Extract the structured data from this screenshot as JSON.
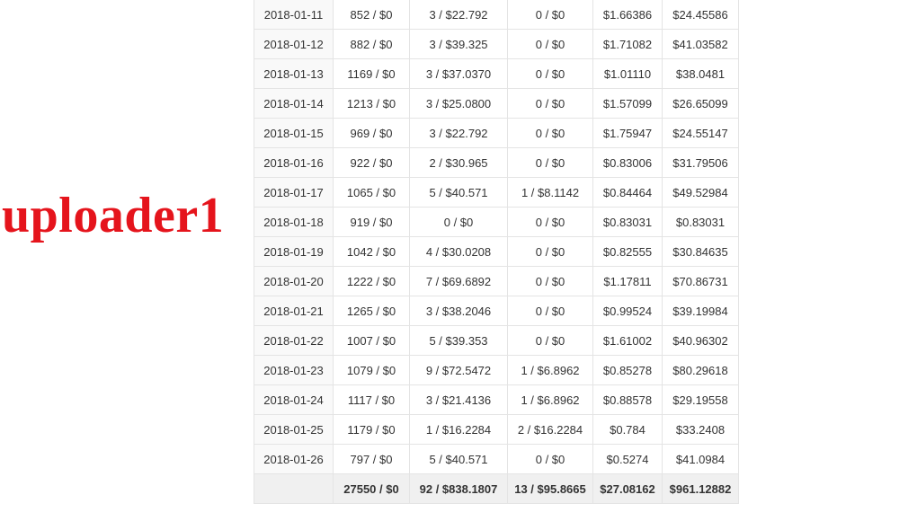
{
  "watermark": "uploader1",
  "rows": [
    {
      "date": "2018-01-11",
      "views": "852 / $0",
      "sales": "3 / $22.792",
      "refs": "0 / $0",
      "extra": "$1.66386",
      "total": "$24.45586"
    },
    {
      "date": "2018-01-12",
      "views": "882 / $0",
      "sales": "3 / $39.325",
      "refs": "0 / $0",
      "extra": "$1.71082",
      "total": "$41.03582"
    },
    {
      "date": "2018-01-13",
      "views": "1169 / $0",
      "sales": "3 / $37.0370",
      "refs": "0 / $0",
      "extra": "$1.01110",
      "total": "$38.0481"
    },
    {
      "date": "2018-01-14",
      "views": "1213 / $0",
      "sales": "3 / $25.0800",
      "refs": "0 / $0",
      "extra": "$1.57099",
      "total": "$26.65099"
    },
    {
      "date": "2018-01-15",
      "views": "969 / $0",
      "sales": "3 / $22.792",
      "refs": "0 / $0",
      "extra": "$1.75947",
      "total": "$24.55147"
    },
    {
      "date": "2018-01-16",
      "views": "922 / $0",
      "sales": "2 / $30.965",
      "refs": "0 / $0",
      "extra": "$0.83006",
      "total": "$31.79506"
    },
    {
      "date": "2018-01-17",
      "views": "1065 / $0",
      "sales": "5 / $40.571",
      "refs": "1 / $8.1142",
      "extra": "$0.84464",
      "total": "$49.52984"
    },
    {
      "date": "2018-01-18",
      "views": "919 / $0",
      "sales": "0 / $0",
      "refs": "0 / $0",
      "extra": "$0.83031",
      "total": "$0.83031"
    },
    {
      "date": "2018-01-19",
      "views": "1042 / $0",
      "sales": "4 / $30.0208",
      "refs": "0 / $0",
      "extra": "$0.82555",
      "total": "$30.84635"
    },
    {
      "date": "2018-01-20",
      "views": "1222 / $0",
      "sales": "7 / $69.6892",
      "refs": "0 / $0",
      "extra": "$1.17811",
      "total": "$70.86731"
    },
    {
      "date": "2018-01-21",
      "views": "1265 / $0",
      "sales": "3 / $38.2046",
      "refs": "0 / $0",
      "extra": "$0.99524",
      "total": "$39.19984"
    },
    {
      "date": "2018-01-22",
      "views": "1007 / $0",
      "sales": "5 / $39.353",
      "refs": "0 / $0",
      "extra": "$1.61002",
      "total": "$40.96302"
    },
    {
      "date": "2018-01-23",
      "views": "1079 / $0",
      "sales": "9 / $72.5472",
      "refs": "1 / $6.8962",
      "extra": "$0.85278",
      "total": "$80.29618"
    },
    {
      "date": "2018-01-24",
      "views": "1117 / $0",
      "sales": "3 / $21.4136",
      "refs": "1 / $6.8962",
      "extra": "$0.88578",
      "total": "$29.19558"
    },
    {
      "date": "2018-01-25",
      "views": "1179 / $0",
      "sales": "1 / $16.2284",
      "refs": "2 / $16.2284",
      "extra": "$0.784",
      "total": "$33.2408"
    },
    {
      "date": "2018-01-26",
      "views": "797 / $0",
      "sales": "5 / $40.571",
      "refs": "0 / $0",
      "extra": "$0.5274",
      "total": "$41.0984"
    }
  ],
  "summary": {
    "date": "",
    "views": "27550 / $0",
    "sales": "92 / $838.1807",
    "refs": "13 / $95.8665",
    "extra": "$27.08162",
    "total": "$961.12882"
  }
}
